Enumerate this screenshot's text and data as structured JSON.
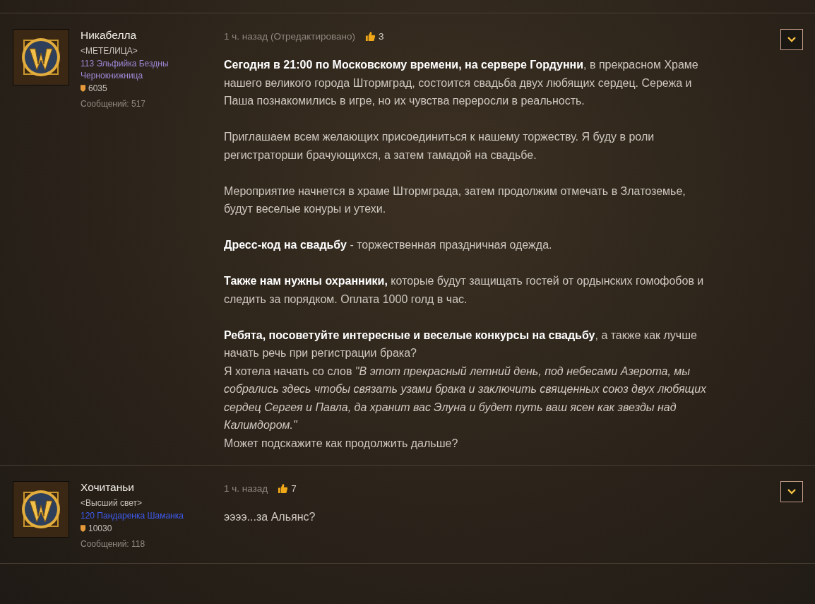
{
  "posts": [
    {
      "author": {
        "name": "Никабелла",
        "guild": "<МЕТЕЛИЦА>",
        "character": "113 Эльфийка Бездны Чернокнижница",
        "color": "#9d88d6",
        "achievement_points": "6035",
        "post_count": "Сообщений: 517"
      },
      "time": "1 ч. назад (Отредактировано)",
      "likes": "3",
      "body": [
        [
          "**Сегодня в 21:00 по Московскому времени, на сервере Гордунни**, в прекрасном Храме нашего великого города Штормград, состоится свадьба двух любящих сердец. Сережа и Паша познакомились в игре, но их чувства переросли в реальность."
        ],
        [
          "Приглашаем всем желающих присоединиться к нашему торжеству. Я буду в роли регистраторши брачующихся, а затем тамадой на свадьбе."
        ],
        [
          "Мероприятие начнется в храме Штормграда, затем продолжим отмечать в Златоземье, будут веселые конуры и утехи."
        ],
        [
          "**Дресс-код на свадьбу** - торжественная праздничная одежда."
        ],
        [
          "**Также нам нужны охранники,** которые будут защищать гостей от ордынских гомофобов и следить за порядком. Оплата 1000 голд в час."
        ],
        [
          "**Ребята, посоветуйте интересные и веселые конкурсы на свадьбу**, а также как лучше начать речь при регистрации брака?",
          "Я хотела начать со слов *\"В этот прекрасный летний день, под небесами Азерота, мы собрались здесь чтобы связать узами брака и заключить священных союз двух любящих сердец Сергея и Павла, да хранит вас Элуна и будет путь ваш ясен как звезды над Калимдором.\"*",
          "Может подскажите как продолжить дальше?"
        ]
      ]
    },
    {
      "author": {
        "name": "Хочитаньи",
        "guild": "<Высший свет>",
        "character": "120 Пандаренка Шаманка",
        "color": "#3d5bf0",
        "achievement_points": "10030",
        "post_count": "Сообщений: 118"
      },
      "time": "1 ч. назад",
      "likes": "7",
      "body": [
        [
          "ээээ...за Альянс?"
        ]
      ]
    }
  ]
}
